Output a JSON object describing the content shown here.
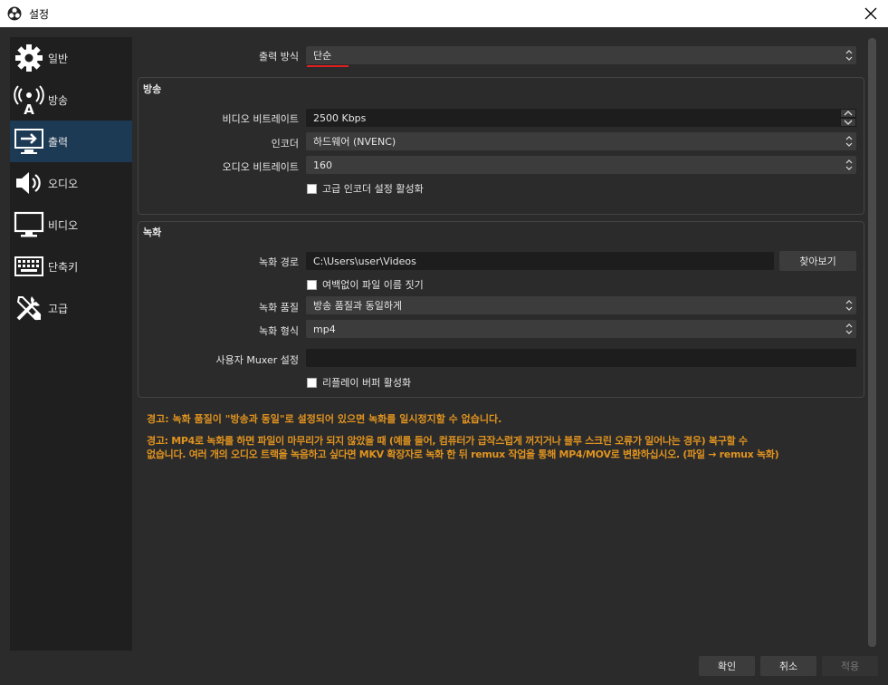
{
  "window": {
    "title": "설정"
  },
  "sidebar": {
    "items": [
      {
        "label": "일반",
        "icon": "gear-icon"
      },
      {
        "label": "방송",
        "icon": "broadcast-icon"
      },
      {
        "label": "출력",
        "icon": "output-icon"
      },
      {
        "label": "오디오",
        "icon": "speaker-icon"
      },
      {
        "label": "비디오",
        "icon": "monitor-icon"
      },
      {
        "label": "단축키",
        "icon": "keyboard-icon"
      },
      {
        "label": "고급",
        "icon": "tools-icon"
      }
    ],
    "active_index": 2
  },
  "output_mode": {
    "label": "출력 방식",
    "value": "단순"
  },
  "stream": {
    "title": "방송",
    "video_bitrate": {
      "label": "비디오 비트레이트",
      "value": "2500 Kbps"
    },
    "encoder": {
      "label": "인코더",
      "value": "하드웨어 (NVENC)"
    },
    "audio_bitrate": {
      "label": "오디오 비트레이트",
      "value": "160"
    },
    "advanced_encoder_checkbox": {
      "label": "고급 인코더 설정 활성화",
      "checked": false
    }
  },
  "recording": {
    "title": "녹화",
    "path": {
      "label": "녹화 경로",
      "value": "C:\\Users\\user\\Videos"
    },
    "browse_label": "찾아보기",
    "no_space_checkbox": {
      "label": "여백없이 파일 이름 짓기",
      "checked": false
    },
    "quality": {
      "label": "녹화 품질",
      "value": "방송 품질과 동일하게"
    },
    "format": {
      "label": "녹화 형식",
      "value": "mp4"
    },
    "muxer": {
      "label": "사용자 Muxer 설정",
      "value": ""
    },
    "replay_checkbox": {
      "label": "리플레이 버퍼 활성화",
      "checked": false
    }
  },
  "warnings": {
    "w1": "경고: 녹화 품질이 \"방송과 동일\"로 설정되어 있으면 녹화를 일시정지할 수 없습니다.",
    "w2a": "경고: MP4로 녹화를 하면 파일이 마무리가 되지 않았을 때 (예를 들어, 컴퓨터가 급작스럽게 꺼지거나 블루 스크린 오류가 일어나는 경우) 복구할 수",
    "w2b": "없습니다. 여러 개의 오디오 트랙을 녹음하고 싶다면 MKV 확장자로 녹화 한 뒤 remux 작업을 통해 MP4/MOV로 변환하십시오. (파일 → remux 녹화)"
  },
  "buttons": {
    "ok": "확인",
    "cancel": "취소",
    "apply": "적용"
  },
  "colors": {
    "warning": "#e0931f",
    "active_sidebar": "#1d3a55",
    "underline": "#e02020"
  }
}
